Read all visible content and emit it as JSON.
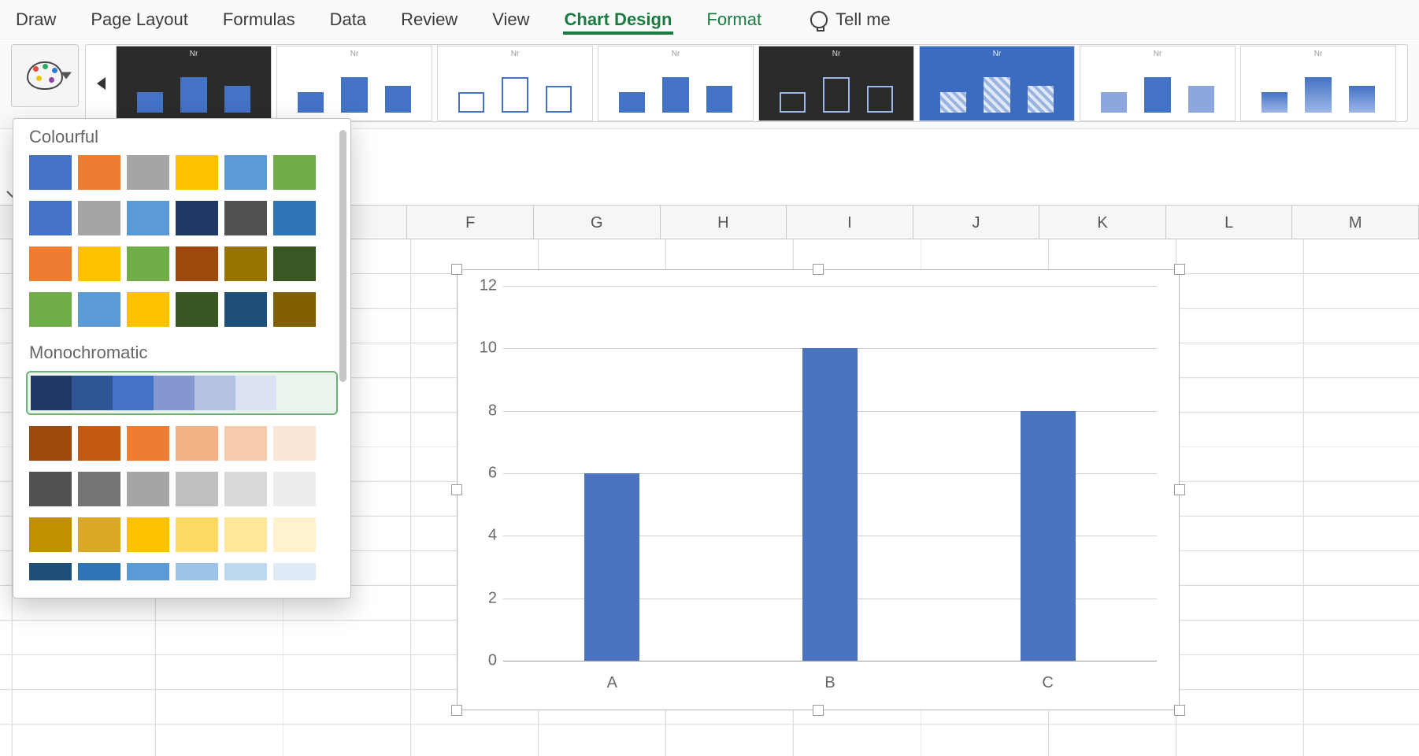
{
  "ribbon": {
    "tabs": [
      "Draw",
      "Page Layout",
      "Formulas",
      "Data",
      "Review",
      "View",
      "Chart Design",
      "Format"
    ],
    "active_tab": "Chart Design",
    "tell_me": "Tell me"
  },
  "style_gallery": {
    "thumb_title": "Nr",
    "thumbs": [
      {
        "bg": "dark",
        "bar_style": "solid"
      },
      {
        "bg": "light",
        "bar_style": "solid"
      },
      {
        "bg": "light",
        "bar_style": "outline"
      },
      {
        "bg": "light",
        "bar_style": "solid"
      },
      {
        "bg": "dark",
        "bar_style": "outline"
      },
      {
        "bg": "blue",
        "bar_style": "hatch"
      },
      {
        "bg": "light",
        "bar_style": "faded"
      },
      {
        "bg": "light",
        "bar_style": "gradient"
      }
    ]
  },
  "color_dropdown": {
    "section_colourful": "Colourful",
    "section_monochrome": "Monochromatic",
    "colourful_rows": [
      [
        "#4472c4",
        "#ed7d31",
        "#a5a5a5",
        "#ffc000",
        "#5b9bd5",
        "#70ad47"
      ],
      [
        "#4472c4",
        "#a5a5a5",
        "#5b9bd5",
        "#1f3864",
        "#525252",
        "#2e75b6"
      ],
      [
        "#ed7d31",
        "#ffc000",
        "#70ad47",
        "#9e480e",
        "#997300",
        "#385723"
      ],
      [
        "#70ad47",
        "#5b9bd5",
        "#ffc000",
        "#375623",
        "#1f4e79",
        "#806000"
      ]
    ],
    "mono_rows": [
      {
        "colors": [
          "#1f3864",
          "#2f5597",
          "#4472c4",
          "#8497d0",
          "#b4c2e2",
          "#d9e1f2"
        ],
        "selected": true
      },
      {
        "colors": [
          "#9e480e",
          "#c55a11",
          "#ed7d31",
          "#f4b183",
          "#f8cbad",
          "#fbe5d6"
        ],
        "selected": false
      },
      {
        "colors": [
          "#525252",
          "#757575",
          "#a5a5a5",
          "#bfbfbf",
          "#d9d9d9",
          "#ededed"
        ],
        "selected": false
      },
      {
        "colors": [
          "#bf9000",
          "#d8a826",
          "#ffc000",
          "#ffd966",
          "#ffe699",
          "#fff2cc"
        ],
        "selected": false
      },
      {
        "colors": [
          "#1f4e79",
          "#2e75b6",
          "#5b9bd5",
          "#9dc3e6",
          "#bdd7ee",
          "#deebf7"
        ],
        "selected": false,
        "partial": true
      }
    ]
  },
  "sheet": {
    "columns": [
      "F",
      "G",
      "H",
      "I",
      "J",
      "K",
      "L",
      "M"
    ]
  },
  "chart_data": {
    "type": "bar",
    "categories": [
      "A",
      "B",
      "C"
    ],
    "values": [
      6,
      10,
      8
    ],
    "title": "",
    "xlabel": "",
    "ylabel": "",
    "ylim": [
      0,
      12
    ],
    "y_ticks": [
      0,
      2,
      4,
      6,
      8,
      10,
      12
    ],
    "bar_color": "#4c73bf"
  }
}
